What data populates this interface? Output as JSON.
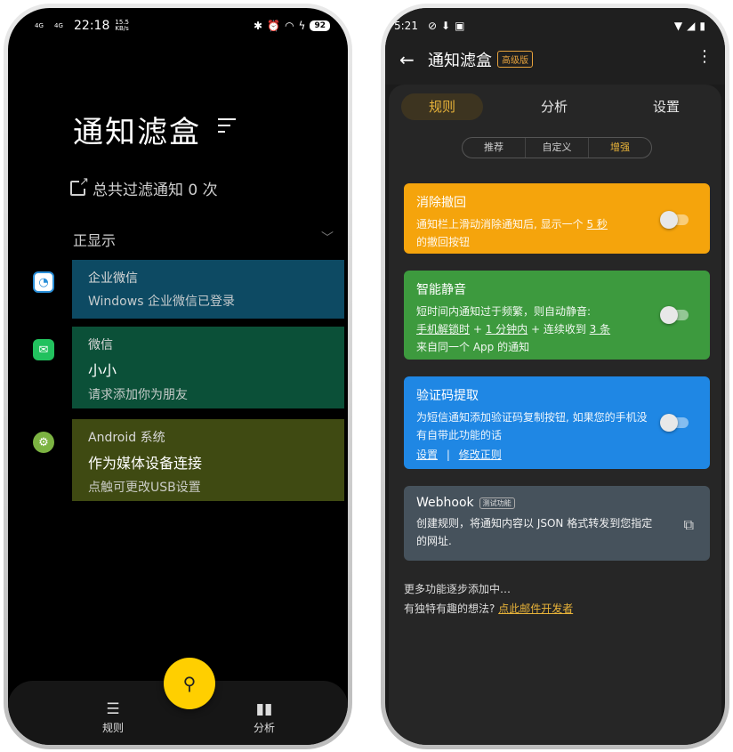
{
  "left": {
    "status": {
      "net1": "4G",
      "net2": "4G",
      "time": "22:18",
      "speed_value": "15.5",
      "speed_unit": "KB/s",
      "battery": "92"
    },
    "app_title": "通知滤盒",
    "filter_summary": "总共过滤通知 0 次",
    "section_label": "正显示",
    "notifications": [
      {
        "app": "企业微信",
        "title": "",
        "body": "Windows 企业微信已登录",
        "color": "#0d4a63"
      },
      {
        "app": "微信",
        "title": "小小",
        "body": "请求添加你为朋友",
        "color": "#0b5038"
      },
      {
        "app": "Android 系统",
        "title": "作为媒体设备连接",
        "body": "点触可更改USB设置",
        "color": "#3f4a12"
      }
    ],
    "nav": {
      "rules": "规则",
      "analysis": "分析"
    }
  },
  "right": {
    "status": {
      "time": "5:21"
    },
    "title": "通知滤盒",
    "badge": "高级版",
    "tabs": [
      "规则",
      "分析",
      "设置"
    ],
    "subtabs": [
      "推荐",
      "自定义",
      "增强"
    ],
    "features": {
      "recall": {
        "title": "消除撤回",
        "desc_pre": "通知栏上滑动消除通知后, 显示一个 ",
        "desc_link": "5 秒",
        "desc_post": "的撤回按钮",
        "color": "#f5a40c"
      },
      "silent": {
        "title": "智能静音",
        "line1": "短时间内通知过于频繁，则自动静音:",
        "opt1": "手机解锁时",
        "plus1": " + ",
        "opt2": "1 分钟内",
        "plus2": " + 连续收到 ",
        "opt3": "3 条",
        "line3": "来自同一个 App 的通知",
        "color": "#3d9a3e"
      },
      "code": {
        "title": "验证码提取",
        "desc": "为短信通知添加验证码复制按钮, 如果您的手机没有自带此功能的话",
        "link1": "设置",
        "sep": "|",
        "link2": "修改正则",
        "color": "#1f87e4"
      },
      "webhook": {
        "title": "Webhook",
        "badge": "测试功能",
        "desc": "创建规则，将通知内容以 JSON 格式转发到您指定的网址.",
        "color": "#46525c"
      }
    },
    "footer": {
      "line1": "更多功能逐步添加中…",
      "line2_pre": "有独特有趣的想法? ",
      "line2_link": "点此邮件开发者"
    }
  }
}
